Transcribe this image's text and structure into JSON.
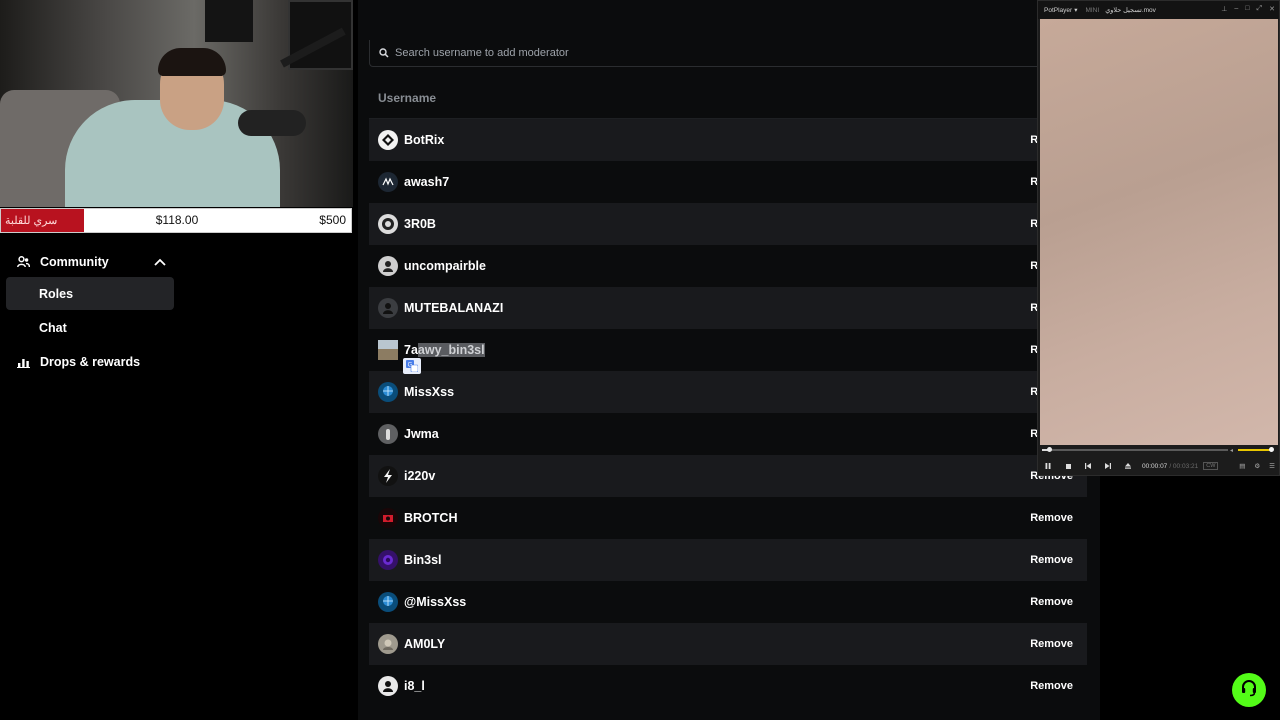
{
  "goal": {
    "name": "سري للقلبة",
    "current": "$118.00",
    "target": "$500",
    "progress": 0.236
  },
  "sidebar": {
    "section_label": "Community",
    "items": [
      {
        "label": "Roles",
        "active": true
      },
      {
        "label": "Chat",
        "active": false
      }
    ],
    "drops_label": "Drops & rewards"
  },
  "search": {
    "placeholder": "Search username to add moderator"
  },
  "table": {
    "header": "Username",
    "remove_label": "Remove",
    "rows": [
      {
        "username": "BotRix",
        "avatar": "diamond",
        "color": "#f2f2f2"
      },
      {
        "username": "awash7",
        "avatar": "awash",
        "color": "#1d2733"
      },
      {
        "username": "3R0B",
        "avatar": "3r0b",
        "color": "#dcdcdc"
      },
      {
        "username": "uncompairble",
        "avatar": "person",
        "color": "#cfcfcf"
      },
      {
        "username": "MUTEBALANAZI",
        "avatar": "person-dark",
        "color": "#3b3d41"
      },
      {
        "username": "7aawy_bin3sl",
        "username_prefix": "7a",
        "username_selected": "awy_bin3sl",
        "avatar": "landscape",
        "color": "#9b8e7a"
      },
      {
        "username": "MissXss",
        "avatar": "globe",
        "color": "#0a4d7a"
      },
      {
        "username": "Jwma",
        "avatar": "figure",
        "color": "#5f6062"
      },
      {
        "username": "i220v",
        "avatar": "bolt",
        "color": "#111111"
      },
      {
        "username": "BROTCH",
        "avatar": "brotch",
        "color": "#1a0608"
      },
      {
        "username": "Bin3sl",
        "avatar": "purple",
        "color": "#35106a"
      },
      {
        "username": "@MissXss",
        "avatar": "globe",
        "color": "#0a4d7a"
      },
      {
        "username": "AM0LY",
        "avatar": "amoly",
        "color": "#9f9a8e"
      },
      {
        "username": "i8_l",
        "avatar": "person-white",
        "color": "#e9e9e9"
      }
    ]
  },
  "player": {
    "app": "PotPlayer",
    "mini": "MINI",
    "filename": "تسجيل حلاوي.mov",
    "time": "00:00:07",
    "duration": "/ 00:03:21",
    "badge": "CW",
    "seek_progress": 0.035
  },
  "icons": {
    "community": "community-icon",
    "drops": "drops-icon",
    "search": "search-icon",
    "help": "headset-icon"
  },
  "colors": {
    "accent": "#53fc18",
    "goal_fill": "#b8121f"
  }
}
